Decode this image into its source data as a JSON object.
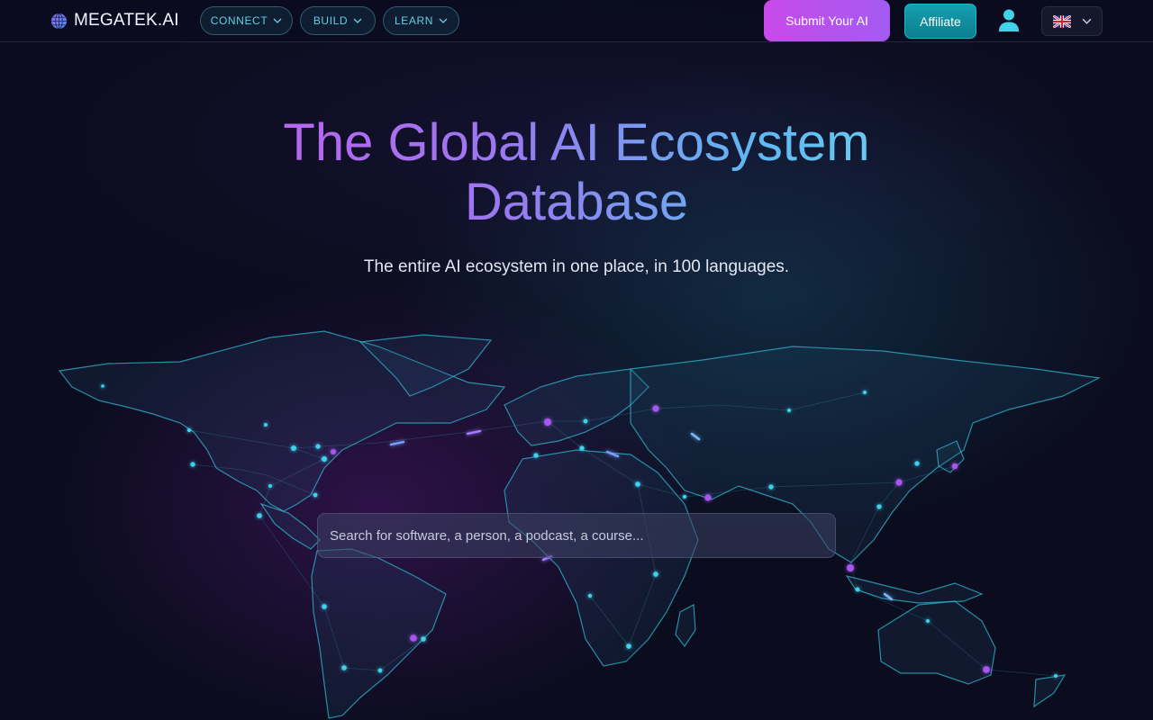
{
  "header": {
    "logo_text": "MEGATEK.AI",
    "nav": [
      {
        "label": "CONNECT"
      },
      {
        "label": "BUILD"
      },
      {
        "label": "LEARN"
      }
    ],
    "submit_label": "Submit Your AI",
    "affiliate_label": "Affiliate"
  },
  "hero": {
    "title": "The Global AI Ecosystem Database",
    "subtitle": "The entire AI ecosystem in one place, in 100 languages."
  },
  "search": {
    "placeholder": "Search for software, a person, a podcast, a course...",
    "value": ""
  },
  "icons": {
    "logo": "globe-icon",
    "nav_chevron": "chevron-down-icon",
    "user": "user-icon",
    "language": "uk-flag-icon"
  },
  "colors": {
    "background": "#0b0c1e",
    "accent_cyan": "#5fd1e8",
    "accent_magenta": "#c84ae8",
    "affiliate_teal": "#14a0b0"
  }
}
